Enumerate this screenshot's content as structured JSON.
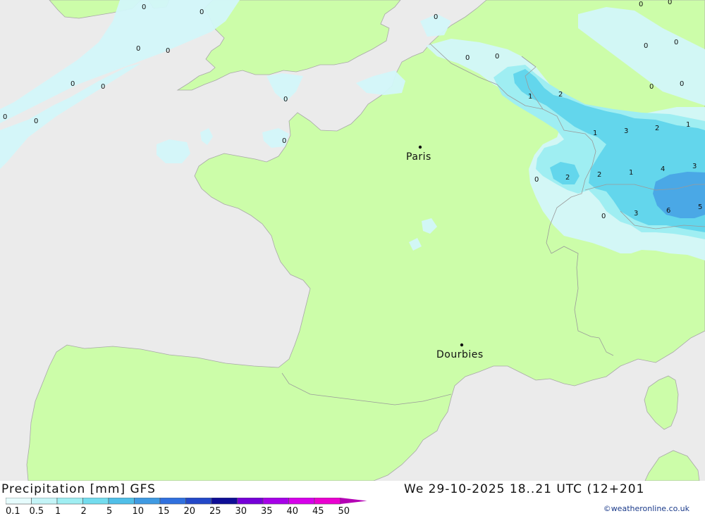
{
  "map": {
    "cities": [
      {
        "name": "Paris"
      },
      {
        "name": "Dourbies"
      }
    ],
    "precip_values": [
      "0",
      "0",
      "0",
      "0",
      "0",
      "0",
      "0",
      "0",
      "0",
      "0",
      "0",
      "0",
      "0",
      "0",
      "0",
      "0",
      "0",
      "0",
      "1",
      "2",
      "1",
      "3",
      "2",
      "1",
      "0",
      "2",
      "2",
      "1",
      "4",
      "3",
      "0",
      "3",
      "6",
      "5"
    ],
    "colors": {
      "sea": "#ebebeb",
      "land": "#ccfda9",
      "precip_light": "#d3f7fa",
      "precip_mid": "#9feef2",
      "precip_mod": "#63d6ec",
      "precip_heavy": "#4aa8e6",
      "border": "#999999"
    }
  },
  "footer": {
    "title": "Precipitation [mm] GFS",
    "datetime": "We 29-10-2025 18..21 UTC (12+201",
    "credit": "©weatheronline.co.uk"
  },
  "legend": {
    "labels": [
      "0.1",
      "0.5",
      "1",
      "2",
      "5",
      "10",
      "15",
      "20",
      "25",
      "30",
      "35",
      "40",
      "45",
      "50"
    ],
    "colors": [
      "#e6fcfd",
      "#c4f4f7",
      "#9feef2",
      "#73dcee",
      "#50bfe8",
      "#3f9ae2",
      "#3070de",
      "#2348c8",
      "#0e0e96",
      "#7500d8",
      "#a600e8",
      "#d600ea",
      "#ea00d0",
      "#b400b4"
    ]
  }
}
